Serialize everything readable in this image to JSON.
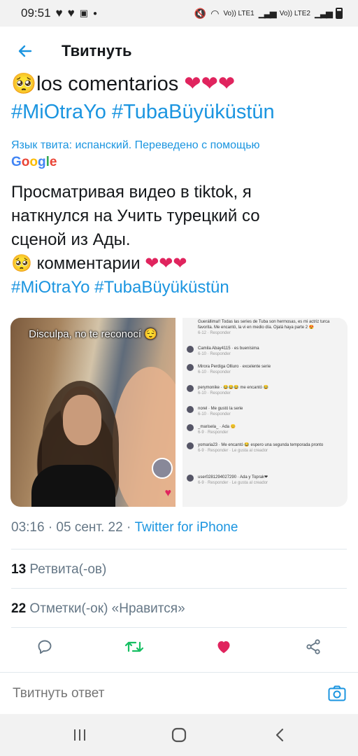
{
  "status_bar": {
    "time": "09:51",
    "net1": "Vo)) LTE1",
    "net2": "Vo)) LTE2"
  },
  "header": {
    "title": "Твитнуть"
  },
  "tweet": {
    "original_line1_text": "los comentarios",
    "original_hashtags": "#MiOtraYo #TubaBüyüküstün",
    "translation_note": "Язык твита: испанский. Переведено с помощью",
    "translation_provider": "Google",
    "translated_lines": [
      "Просматривая видео в tiktok, я",
      "наткнулся на Учить турецкий со",
      "сценой из Ады."
    ],
    "translated_comment": "комментарии",
    "translated_hashtags": "#MiOtraYo #TubaBüyüküstün",
    "media": {
      "image1_caption": "Disculpa, no te reconocí 😌",
      "image2_comments": [
        {
          "text": "Guerállima!! Todas las series de Tuba son hermosas, es mi actriz turca favorita. Me encantó, la vi en medio día. Ojalá haya parte 2 😍",
          "meta": "6-12 · Responder"
        },
        {
          "text": "Camila Abay4115 · es buenísima",
          "meta": "6-10 · Responder"
        },
        {
          "text": "Mirora Perdiga Olliuro · excelente serie",
          "meta": "6-10 · Responder"
        },
        {
          "text": "perymonike · 😂😂😂 me encantó 😂",
          "meta": "6-10 · Responder"
        },
        {
          "text": "norel · Me gustó la serie",
          "meta": "6-10 · Responder"
        },
        {
          "text": "_marisela_ · Ada 😊",
          "meta": "6-9 · Responder"
        },
        {
          "text": "yomaria23 · Me encantó 😂 espero una segunda temporada pronto",
          "meta": "6-9 · Responder · Le gusta al creador"
        },
        {
          "text": "user0281294027290 · Ada y Toprak❤",
          "meta": "6-9 · Responder · Le gusta al creador"
        }
      ]
    },
    "timestamp": "03:16 · 05 сент. 22 · ",
    "source": "Twitter for iPhone",
    "retweets_count": "13",
    "retweets_label": "Ретвита(-ов)",
    "likes_count": "22",
    "likes_label": "Отметки(-ок) «Нравится»"
  },
  "reply": {
    "placeholder": "Твитнуть ответ"
  },
  "colors": {
    "link": "#1b95e0",
    "like": "#e0245e",
    "retweet": "#17bf63",
    "muted": "#657786"
  },
  "icons": [
    "back-arrow-icon",
    "reply-icon",
    "retweet-icon",
    "like-icon",
    "share-icon",
    "camera-icon",
    "recents-icon",
    "home-icon",
    "nav-back-icon"
  ]
}
